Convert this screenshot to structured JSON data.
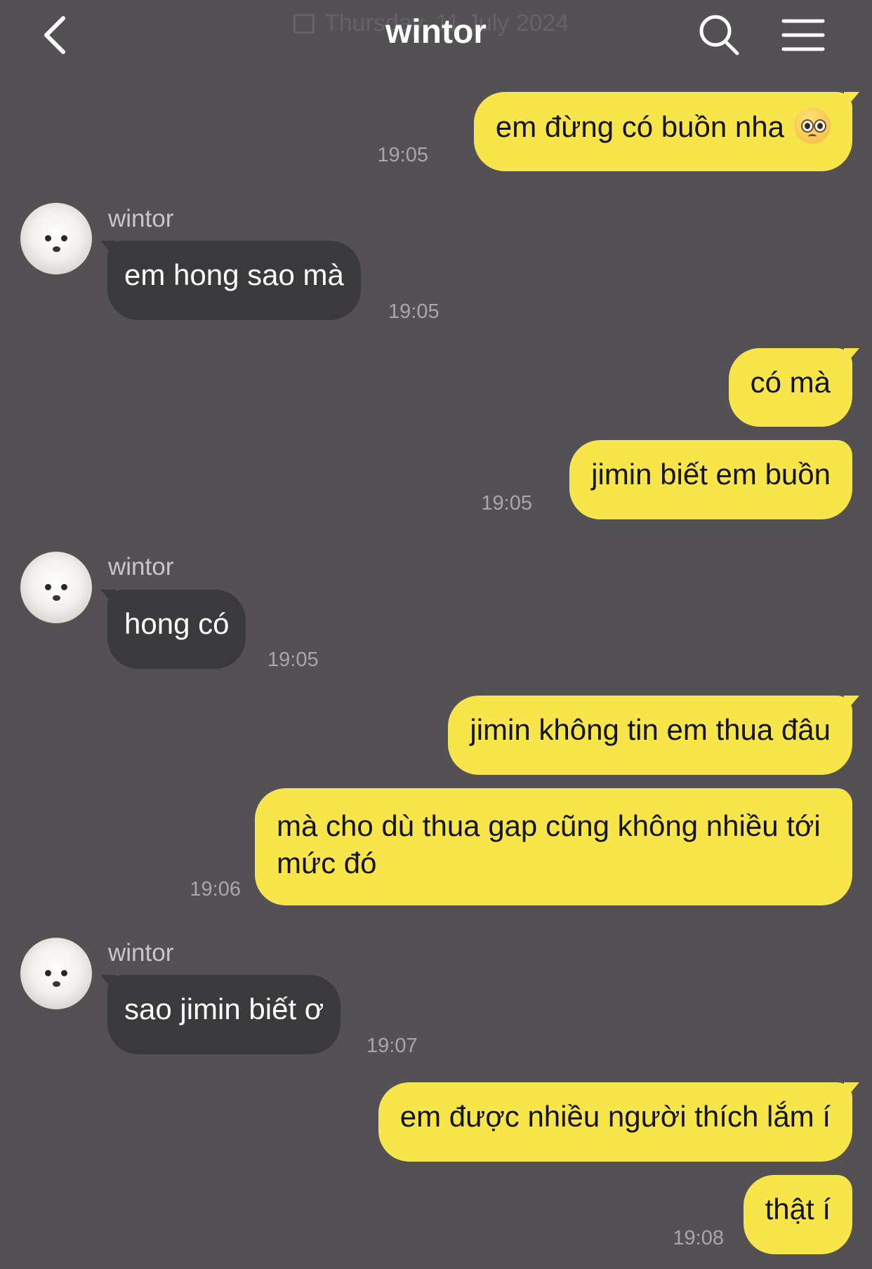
{
  "header": {
    "title": "wintor",
    "date_ghost": "Thursday, 11 July 2024"
  },
  "messages": [
    {
      "side": "me",
      "text": "em đừng có buồn nha",
      "emoji": "pleading-face",
      "time": "19:05"
    },
    {
      "side": "them",
      "sender": "wintor",
      "text": "em hong sao mà",
      "time": "19:05"
    },
    {
      "side": "me",
      "text": "có mà"
    },
    {
      "side": "me",
      "text": "jimin biết em buồn",
      "time": "19:05"
    },
    {
      "side": "them",
      "sender": "wintor",
      "text": "hong có",
      "time": "19:05"
    },
    {
      "side": "me",
      "text": "jimin không tin em thua đâu"
    },
    {
      "side": "me",
      "text": "mà cho dù thua gap cũng không nhiều tới mức đó",
      "time": "19:06"
    },
    {
      "side": "them",
      "sender": "wintor",
      "text": "sao jimin biết ơ",
      "time": "19:07"
    },
    {
      "side": "me",
      "text": "em được nhiều người thích lắm í"
    },
    {
      "side": "me",
      "text": "thật í",
      "time": "19:08"
    }
  ],
  "colors": {
    "background": "#535153",
    "my_bubble": "#f7e54a",
    "their_bubble": "#3a393b",
    "timestamp": "#a9a6aa"
  },
  "icons": [
    "back-arrow-icon",
    "search-icon",
    "hamburger-menu-icon",
    "calendar-icon"
  ]
}
